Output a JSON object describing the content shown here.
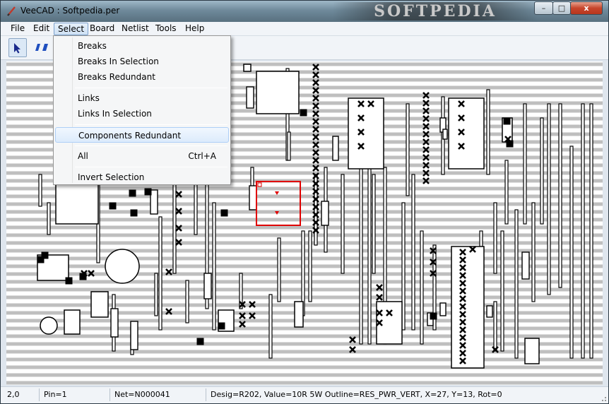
{
  "window": {
    "app_icon": "pencil-icon",
    "title": "VeeCAD : Softpedia.per",
    "watermark": "SOFTPEDIA",
    "controls": {
      "minimize": "–",
      "maximize": "□",
      "close": "x"
    }
  },
  "menubar": {
    "items": [
      {
        "label": "File"
      },
      {
        "label": "Edit"
      },
      {
        "label": "Select"
      },
      {
        "label": "Board"
      },
      {
        "label": "Netlist"
      },
      {
        "label": "Tools"
      },
      {
        "label": "Help"
      }
    ],
    "active": "Select"
  },
  "toolbar": {
    "tools": [
      {
        "icon": "arrow-pointer-icon",
        "active": true
      },
      {
        "icon": "track-cut-icon",
        "active": false
      }
    ]
  },
  "select_menu": {
    "items": [
      {
        "label": "Breaks",
        "accel": ""
      },
      {
        "label": "Breaks In Selection",
        "accel": ""
      },
      {
        "label": "Breaks Redundant",
        "accel": ""
      },
      {
        "label": "Links",
        "accel": ""
      },
      {
        "label": "Links In Selection",
        "accel": ""
      },
      {
        "label": "Components Redundant",
        "accel": "",
        "highlighted": true
      },
      {
        "label": "All",
        "accel": "Ctrl+A"
      },
      {
        "label": "Invert Selection",
        "accel": ""
      }
    ]
  },
  "colors": {
    "strip": "#bfbfbf",
    "selection": "#e00000",
    "menu_highlight": "#dcebfc"
  },
  "statusbar": {
    "coords": "2,0",
    "pin": "Pin=1",
    "net": "Net=N000041",
    "info": "Desig=R202, Value=10R 5W Outline=RES_PWR_VERT, X=27, Y=13, Rot=0"
  }
}
